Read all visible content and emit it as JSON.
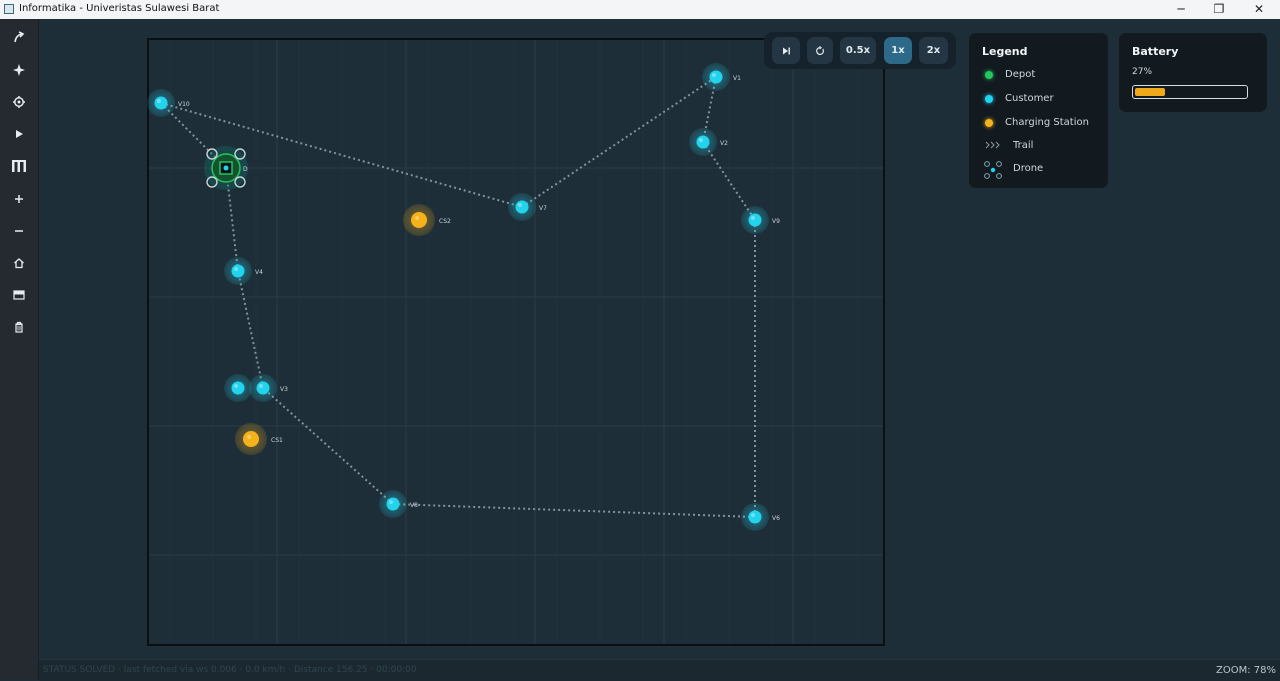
{
  "window": {
    "title": "Informatika - Univeristas Sulawesi Barat",
    "controls": {
      "minimize": "─",
      "maximize": "❐",
      "close": "✕"
    }
  },
  "sidebar": {
    "items": [
      {
        "name": "export",
        "icon": "arrow-up-right-icon",
        "glyph": "⤴"
      },
      {
        "name": "star",
        "icon": "sparkle-icon",
        "glyph": "✦"
      },
      {
        "name": "settings",
        "icon": "gear-icon",
        "glyph": "⚙"
      },
      {
        "name": "play",
        "icon": "play-icon",
        "glyph": "▶"
      },
      {
        "name": "library",
        "icon": "library-icon",
        "glyph": "▥"
      },
      {
        "name": "zoom-in",
        "icon": "plus-icon",
        "glyph": "+"
      },
      {
        "name": "zoom-out",
        "icon": "minus-icon",
        "glyph": "−"
      },
      {
        "name": "home",
        "icon": "home-icon",
        "glyph": "⌂"
      },
      {
        "name": "layers",
        "icon": "layers-icon",
        "glyph": "▤"
      },
      {
        "name": "trash",
        "icon": "trash-icon",
        "glyph": "🗑"
      }
    ]
  },
  "playback": {
    "step_icon": "⏭",
    "reset_icon": "↻",
    "speeds": [
      "0.5x",
      "1x",
      "2x"
    ],
    "active_speed": "1x"
  },
  "legend": {
    "title": "Legend",
    "items": [
      {
        "label": "Depot",
        "color": "#22c55e"
      },
      {
        "label": "Customer",
        "color": "#22d3ee"
      },
      {
        "label": "Charging Station",
        "color": "#f5b21b"
      },
      {
        "label": "Trail",
        "icon": ">>>"
      },
      {
        "label": "Drone",
        "icon": "drone-icon"
      }
    ]
  },
  "battery": {
    "title": "Battery",
    "percent_label": "27%",
    "level": 0.27,
    "color": "#f0a91b"
  },
  "map": {
    "nodes": [
      {
        "label": "V10",
        "type": "customer"
      },
      {
        "label": "D",
        "type": "depot"
      },
      {
        "label": "V1",
        "type": "customer"
      },
      {
        "label": "V2",
        "type": "customer"
      },
      {
        "label": "V7",
        "type": "customer"
      },
      {
        "label": "CS2",
        "type": "charging"
      },
      {
        "label": "V9",
        "type": "customer"
      },
      {
        "label": "V4",
        "type": "customer"
      },
      {
        "label": "V3",
        "type": "customer"
      },
      {
        "label": "CS1",
        "type": "charging"
      },
      {
        "label": "V8",
        "type": "customer"
      },
      {
        "label": "V6",
        "type": "customer"
      }
    ]
  },
  "status": {
    "left": "STATUS SOLVED · last fetched via ws 0.006 · 0.0 km/h · Distance 156.25 · 00:00:00",
    "zoom": "ZOOM: 78%"
  },
  "colors": {
    "customer": "#22d3ee",
    "charging": "#f5b21b",
    "depot": "#22c55e",
    "trail": "#8a9ba6"
  }
}
